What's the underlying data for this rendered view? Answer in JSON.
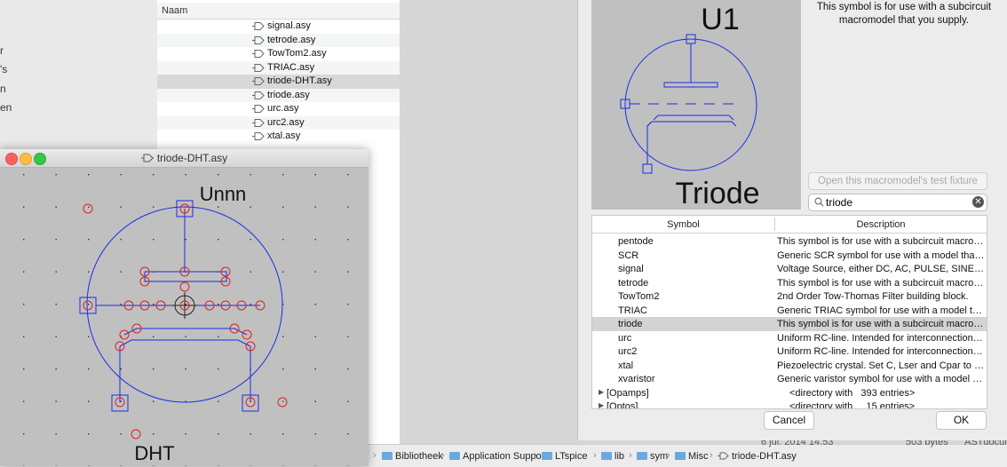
{
  "finder": {
    "sidebar_items": [
      "r",
      "'s",
      "n",
      "en"
    ],
    "column_header": "Naam",
    "files": [
      {
        "name": "signal.asy"
      },
      {
        "name": "tetrode.asy"
      },
      {
        "name": "TowTom2.asy"
      },
      {
        "name": "TRIAC.asy"
      },
      {
        "name": "triode-DHT.asy",
        "selected": true
      },
      {
        "name": "triode.asy"
      },
      {
        "name": "urc.asy"
      },
      {
        "name": "urc2.asy"
      },
      {
        "name": "xtal.asy"
      }
    ],
    "path": [
      "Bibliotheek",
      "Application Support",
      "LTspice",
      "lib",
      "sym",
      "Misc",
      "triode-DHT.asy"
    ],
    "meta": {
      "date": "6 jul. 2014 14:53",
      "size": "503 bytes",
      "kind": "ASTdocum"
    }
  },
  "dialog": {
    "preview": {
      "ref_label": "U1",
      "name_label": "Triode"
    },
    "description": "This symbol is for use with a subcircuit macromodel that you supply.",
    "fixture_button": "Open this macromodel's test fixture",
    "search": {
      "value": "triode"
    },
    "columns": {
      "symbol": "Symbol",
      "description": "Description"
    },
    "rows": [
      {
        "symbol": "pentode",
        "description": "This symbol is for use with a subcircuit macromodel that you supply."
      },
      {
        "symbol": "SCR",
        "description": "Generic SCR symbol for use with a model that you supply."
      },
      {
        "symbol": "signal",
        "description": "Voltage Source, either DC, AC, PULSE, SINE, etc."
      },
      {
        "symbol": "tetrode",
        "description": "This symbol is for use with a subcircuit macromodel that you supply."
      },
      {
        "symbol": "TowTom2",
        "description": "2nd Order Tow-Thomas Filter building block."
      },
      {
        "symbol": "TRIAC",
        "description": "Generic TRIAC symbol for use with a model that you supply."
      },
      {
        "symbol": "triode",
        "description": "This symbol is for use with a subcircuit macromodel that you supply.",
        "selected": true
      },
      {
        "symbol": "urc",
        "description": "Uniform RC-line.  Intended for interconnection modeling."
      },
      {
        "symbol": "urc2",
        "description": "Uniform RC-line.  Intended for interconnection modeling."
      },
      {
        "symbol": "xtal",
        "description": "Piezoelectric crystal.  Set C, Lser and Cpar to model."
      },
      {
        "symbol": "xvaristor",
        "description": "Generic varistor symbol for use with a model that you supply."
      }
    ],
    "dirs": [
      {
        "name": "[Opamps]",
        "description": "<directory with   393 entries>"
      },
      {
        "name": "[Optos]",
        "description": "<directory with     15 entries>"
      }
    ],
    "cancel_label": "Cancel",
    "ok_label": "OK"
  },
  "editor": {
    "title": "triode-DHT.asy",
    "labels": {
      "instname": "Unnn",
      "value": "DHT"
    }
  },
  "colors": {
    "symbol_line": "#1c2de6",
    "pin_circle": "#e02020",
    "pin_box": "#1c2de6",
    "canvas": "#c0c0c0"
  }
}
